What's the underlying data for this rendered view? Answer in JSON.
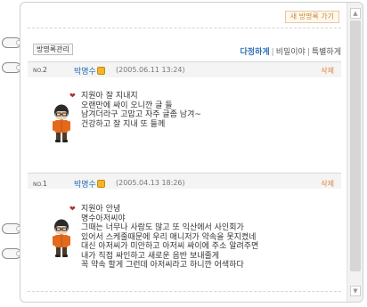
{
  "header": {
    "go_guestbook_label": "새 방명록 가기"
  },
  "toolbar": {
    "manage_label": "방명록관리",
    "filters": [
      {
        "label": "다정하게",
        "active": true
      },
      {
        "label": "비밀이야",
        "active": false
      },
      {
        "label": "특별하게",
        "active": false
      }
    ]
  },
  "entries": [
    {
      "no_prefix": "NO.",
      "no": "2",
      "author": "박명수",
      "date": "(2005.06.11 13:24)",
      "delete_label": "삭제",
      "heart": "❤",
      "message": "지원아 잘 지내지\n오랜만에 싸이 오니깐 글 들\n남겨더라구 고맙고 자주 글좀 남겨~\n건강하고 잘 지내 또 들께"
    },
    {
      "no_prefix": "NO.",
      "no": "1",
      "author": "박명수",
      "date": "(2005.04.13 18:26)",
      "delete_label": "삭제",
      "heart": "❤",
      "message": "지원아 안녕\n명수아저씨야\n그때는 너무나 사람도 많고 또 익산에서 사인회가\n있어서 스케줄때문에 우리 매니저가 약속을 못지켰네\n대신 아저씨가 미안하고 아저씨 싸이에 주소 알려주면\n내가 직접 싸인하고 새로운 음반 보내줄게\n꼭 약속 할게 그런데 아저씨라고 하니깐 어색하다"
    }
  ],
  "colors": {
    "link_blue": "#2a6fb3",
    "delete_orange": "#e2833a",
    "heart_red": "#b03030"
  },
  "icons": {
    "author_badge": "mini-room-icon",
    "avatar": "minime-avatar-icon",
    "ring": "binder-ring-icon"
  }
}
